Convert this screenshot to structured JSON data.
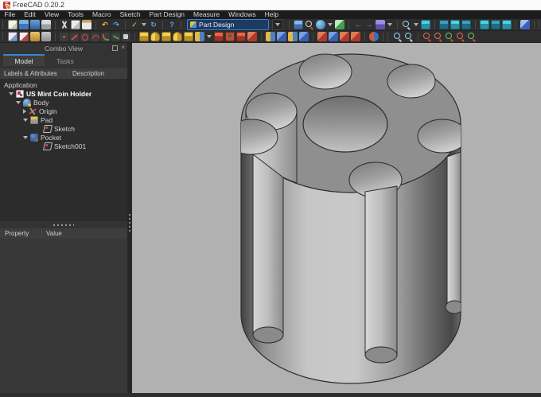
{
  "window": {
    "title": "FreeCAD 0.20.2"
  },
  "menu": {
    "items": [
      "File",
      "Edit",
      "View",
      "Tools",
      "Macro",
      "Sketch",
      "Part Design",
      "Measure",
      "Windows",
      "Help"
    ]
  },
  "toolbar_row1": {
    "workbench_selector": {
      "value": "Part Design"
    },
    "groups": [
      {
        "name": "file",
        "icons": [
          "new-document",
          "open-document",
          "save-document",
          "print"
        ]
      },
      {
        "name": "clipboard",
        "icons": [
          "cut",
          "copy",
          "paste"
        ]
      },
      {
        "name": "undo-redo",
        "icons": [
          "undo",
          "redo"
        ]
      },
      {
        "name": "validate-refresh",
        "icons": [
          "validate-sketch-dropdown",
          "refresh"
        ]
      },
      {
        "name": "help",
        "icons": [
          "whats-this"
        ]
      },
      {
        "name": "structure",
        "icons": [
          "create-part"
        ]
      },
      {
        "name": "view-style",
        "icons": [
          "fit-all",
          "draw-style",
          "select-box"
        ]
      },
      {
        "name": "navigation",
        "icons": [
          "back",
          "forward",
          "linked-view"
        ]
      },
      {
        "name": "zoom-iso",
        "icons": [
          "zoom",
          "isometric-view"
        ]
      },
      {
        "name": "standard-views-a",
        "icons": [
          "front-view",
          "top-view",
          "right-view"
        ]
      },
      {
        "name": "standard-views-b",
        "icons": [
          "rear-view",
          "bottom-view",
          "left-view"
        ]
      },
      {
        "name": "measure",
        "icons": [
          "measure-distance"
        ]
      },
      {
        "name": "part-design-helper",
        "icons": [
          "create-body",
          "create-group",
          "create-datum",
          "create-local-cs"
        ]
      }
    ]
  },
  "toolbar_row2": {
    "groups": [
      {
        "name": "sketcher",
        "icons": [
          "create-sketch",
          "edit-sketch",
          "leave-sketch",
          "map-sketch"
        ]
      },
      {
        "name": "sketcher-geometry",
        "icons": [
          "create-point",
          "create-line",
          "create-circle",
          "create-arc",
          "create-fillet",
          "trim-edge",
          "external-geometry"
        ]
      },
      {
        "name": "pd-additive",
        "icons": [
          "pad",
          "revolution",
          "additive-loft",
          "additive-pipe",
          "additive-helix",
          "additive-primitive"
        ]
      },
      {
        "name": "pd-subtractive",
        "icons": [
          "pocket",
          "hole",
          "groove",
          "subtractive-loft"
        ]
      },
      {
        "name": "pd-transform",
        "icons": [
          "mirrored",
          "linear-pattern",
          "polar-pattern",
          "multitransform"
        ]
      },
      {
        "name": "pd-dressup",
        "icons": [
          "fillet",
          "chamfer",
          "draft",
          "thickness"
        ]
      },
      {
        "name": "pd-boolean",
        "icons": [
          "boolean-operation"
        ]
      },
      {
        "name": "measure-a",
        "icons": [
          "measure-linear",
          "measure-angular"
        ]
      },
      {
        "name": "measure-b",
        "icons": [
          "measure-refresh",
          "measure-clear-all",
          "measure-toggle-all",
          "measure-toggle-3d"
        ]
      }
    ]
  },
  "combo_view": {
    "title": "Combo View",
    "tabs": [
      {
        "label": "Model",
        "active": true
      },
      {
        "label": "Tasks",
        "active": false
      }
    ],
    "tree_headers": [
      "Labels & Attributes",
      "Description"
    ],
    "tree": {
      "root_label": "Application",
      "items": [
        {
          "label": "US Mint Coin Holder",
          "icon": "freecad-document",
          "expanded": true,
          "level": 1,
          "bold": true
        },
        {
          "label": "Body",
          "icon": "body",
          "expanded": true,
          "level": 2
        },
        {
          "label": "Origin",
          "icon": "origin",
          "expanded": false,
          "level": 3
        },
        {
          "label": "Pad",
          "icon": "pad-feature",
          "expanded": true,
          "level": 3
        },
        {
          "label": "Sketch",
          "icon": "sketch",
          "expanded": null,
          "level": 4
        },
        {
          "label": "Pocket",
          "icon": "pocket-feature",
          "expanded": true,
          "level": 3
        },
        {
          "label": "Sketch001",
          "icon": "sketch",
          "expanded": null,
          "level": 4
        }
      ]
    },
    "property_headers": [
      "Property",
      "Value"
    ]
  },
  "viewport": {
    "background_color": "#b1b1b1",
    "accent_color": "#3f83c9",
    "model": {
      "name": "US Mint Coin Holder",
      "description": "Gray cylinder shown in isometric view with a large central bore and six outer cylindrical pockets cut through the top face, leaving notches in the rim and open slots down the side wall",
      "top_face_color": "#8f8f8f",
      "edge_color": "#2b2b2b"
    }
  }
}
